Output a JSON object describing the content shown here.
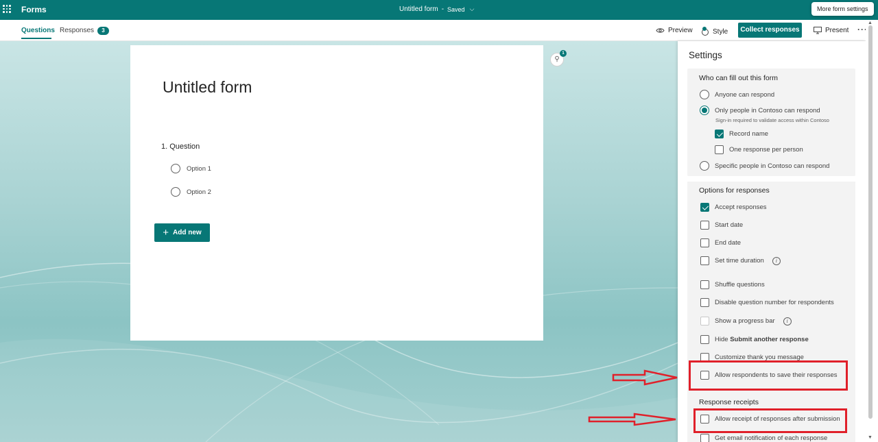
{
  "topbar": {
    "app_name": "Forms",
    "doc_title": "Untitled form",
    "separator": "-",
    "save_status": "Saved",
    "tooltip": "More form settings"
  },
  "tabs": {
    "questions": "Questions",
    "responses": "Responses",
    "responses_count": "3"
  },
  "toolbar": {
    "preview": "Preview",
    "style": "Style",
    "collect": "Collect responses",
    "present": "Present",
    "more": "···"
  },
  "form": {
    "title": "Untitled form",
    "question": "1. Question",
    "options": [
      "Option 1",
      "Option 2"
    ],
    "add_new": "Add new",
    "idea_badge": "1"
  },
  "settings": {
    "title": "Settings",
    "who": {
      "title": "Who can fill out this form",
      "anyone": "Anyone can respond",
      "org": "Only people in Contoso can respond",
      "org_note": "Sign-in required to validate access within Contoso",
      "record_name": "Record name",
      "one_response": "One response per person",
      "specific": "Specific people in Contoso can respond"
    },
    "options": {
      "title": "Options for responses",
      "accept": "Accept responses",
      "start_date": "Start date",
      "end_date": "End date",
      "time_duration": "Set time duration",
      "shuffle": "Shuffle questions",
      "disable_number": "Disable question number for respondents",
      "progress_bar": "Show a progress bar",
      "hide_prefix": "Hide",
      "hide_bold": "Submit another response",
      "thank_you": "Customize thank you message",
      "save_responses": "Allow respondents to save their responses"
    },
    "receipts": {
      "title": "Response receipts",
      "allow_receipt": "Allow receipt of responses after submission",
      "email_notify": "Get email notification of each response"
    }
  },
  "colors": {
    "brand": "#077776",
    "highlight": "#e0202a"
  }
}
